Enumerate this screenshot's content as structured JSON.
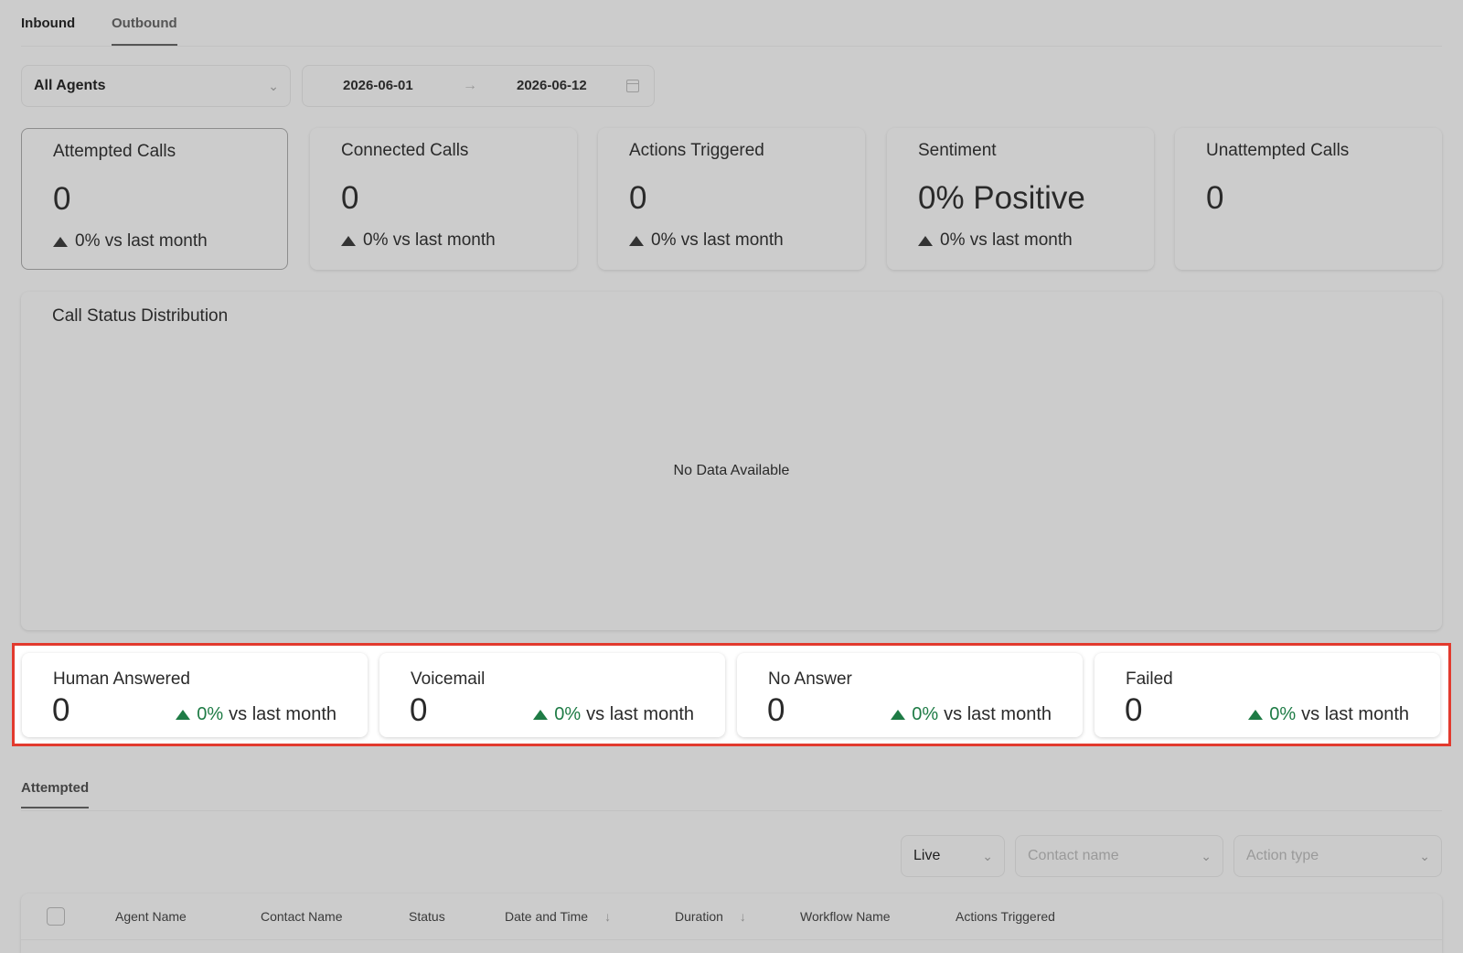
{
  "top_tabs": [
    {
      "label": "Inbound"
    },
    {
      "label": "Outbound"
    }
  ],
  "filters": {
    "agent_select": "All Agents",
    "date_start": "2026-06-01",
    "date_end": "2026-06-12",
    "arrow": "→"
  },
  "stats": [
    {
      "label": "Attempted Calls",
      "value": "0",
      "trend": "0% vs last month"
    },
    {
      "label": "Connected Calls",
      "value": "0",
      "trend": "0% vs last month"
    },
    {
      "label": "Actions Triggered",
      "value": "0",
      "trend": "0% vs last month"
    },
    {
      "label": "Sentiment",
      "value": "0% Positive",
      "trend": "0% vs last month"
    },
    {
      "label": "Unattempted Calls",
      "value": "0"
    }
  ],
  "chart": {
    "title": "Call Status Distribution",
    "empty_text": "No Data Available"
  },
  "status_cards": [
    {
      "label": "Human Answered",
      "value": "0",
      "pct": "0%",
      "suffix": "vs last month"
    },
    {
      "label": "Voicemail",
      "value": "0",
      "pct": "0%",
      "suffix": "vs last month"
    },
    {
      "label": "No Answer",
      "value": "0",
      "pct": "0%",
      "suffix": "vs last month"
    },
    {
      "label": "Failed",
      "value": "0",
      "pct": "0%",
      "suffix": "vs last month"
    }
  ],
  "bottom_tab": "Attempted",
  "table_filters": {
    "live": "Live",
    "contact_placeholder": "Contact name",
    "action_placeholder": "Action type"
  },
  "table_headers": {
    "agent_name": "Agent Name",
    "contact_name": "Contact Name",
    "status": "Status",
    "date_time": "Date and Time",
    "duration": "Duration",
    "workflow_name": "Workflow Name",
    "actions_triggered": "Actions Triggered"
  },
  "colors": {
    "background": "#cccccc",
    "highlight_border": "#e23a2e",
    "positive_trend": "#1e7b45"
  }
}
